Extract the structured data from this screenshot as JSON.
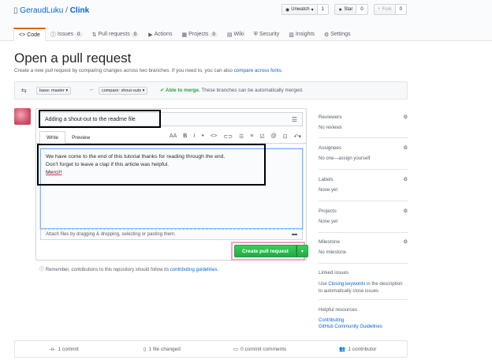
{
  "repo": {
    "owner": "GeraudLuku",
    "separator": "/",
    "name": "Clink"
  },
  "actions": [
    {
      "label": "Unwatch",
      "count": "1"
    },
    {
      "label": "Star",
      "count": "0"
    },
    {
      "label": "Fork",
      "count": "0"
    }
  ],
  "nav": {
    "tabs": [
      {
        "label": "Code"
      },
      {
        "label": "Issues",
        "count": "0"
      },
      {
        "label": "Pull requests",
        "count": "0"
      },
      {
        "label": "Actions"
      },
      {
        "label": "Projects",
        "count": "0"
      },
      {
        "label": "Wiki"
      },
      {
        "label": "Security"
      },
      {
        "label": "Insights"
      },
      {
        "label": "Settings"
      }
    ]
  },
  "page": {
    "title": "Open a pull request",
    "subtitle": "Create a new pull request by comparing changes across two branches. If you need to, you can also",
    "subtitle_link": "compare across forks."
  },
  "range": {
    "base": "base: master",
    "compare": "compare: shout-outs",
    "merge_status": "Able to merge.",
    "merge_text": "These branches can be automatically merged."
  },
  "form": {
    "title_value": "Adding a shout-out to the readme file",
    "write_tab": "Write",
    "preview_tab": "Preview",
    "body_lines": [
      "We have come to the end of this tutorial thanks for reading through the end.",
      "Don't forget to leave a clap if this article was helpful.",
      "Merci!!"
    ],
    "attach_text": "Attach files by dragging & dropping, selecting or pasting them.",
    "create_label": "Create pull request",
    "remember_text": "Remember, contributions to this repository should follow its",
    "remember_link": "contributing guidelines."
  },
  "sidebar": {
    "reviewers": {
      "label": "Reviewers",
      "value": "No reviews"
    },
    "assignees": {
      "label": "Assignees",
      "value": "No one—assign yourself"
    },
    "labels": {
      "label": "Labels",
      "value": "None yet"
    },
    "projects": {
      "label": "Projects",
      "value": "None yet"
    },
    "milestone": {
      "label": "Milestone",
      "value": "No milestone"
    },
    "linked": {
      "label": "Linked issues",
      "prefix": "Use",
      "link": "Closing keywords",
      "suffix": "in the description to automatically close issues"
    },
    "helpful": {
      "label": "Helpful resources",
      "links": [
        "Contributing",
        "GitHub Community Guidelines"
      ]
    }
  },
  "stats": {
    "commits": "1 commit",
    "files": "1 file changed",
    "comments": "0 commit comments",
    "contributors": "1 contributor"
  },
  "colors": {
    "accent": "#0366d6",
    "merge_green": "#28a745",
    "tab_orange": "#e36209",
    "highlight_pink": "#f3a6c8"
  }
}
